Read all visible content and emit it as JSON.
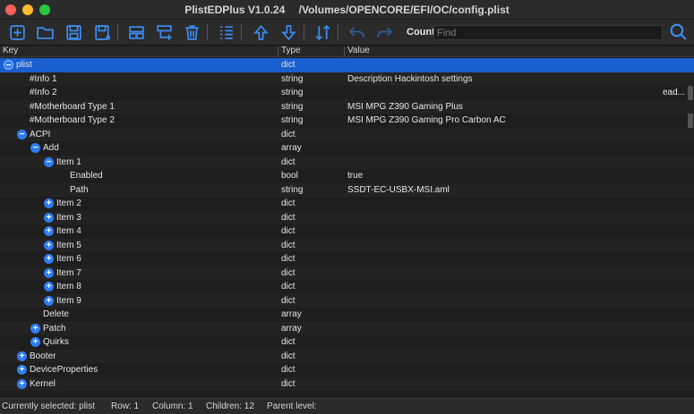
{
  "window": {
    "app_title": "PlistEDPlus  V1.0.24",
    "file_path": "/Volumes/OPENCORE/EFI/OC/config.plist"
  },
  "toolbar": {
    "count_label": "Count",
    "find_placeholder": "Find"
  },
  "columns": {
    "key": "Key",
    "type": "Type",
    "value": "Value"
  },
  "rows": [
    {
      "key": "plist",
      "type": "dict",
      "value": "",
      "toggle": "−",
      "level": 0
    },
    {
      "key": "#Info 1",
      "type": "string",
      "value": "Description Hackintosh settings",
      "toggle": "",
      "level": 1
    },
    {
      "key": "#Info 2",
      "type": "string",
      "value": "ead...",
      "toggle": "",
      "level": 1
    },
    {
      "key": "#Motherboard Type 1",
      "type": "string",
      "value": "MSI MPG Z390 Gaming Plus",
      "toggle": "",
      "level": 1
    },
    {
      "key": "#Motherboard Type 2",
      "type": "string",
      "value": "MSI MPG Z390 Gaming Pro Carbon AC",
      "toggle": "",
      "level": 1
    },
    {
      "key": "ACPI",
      "type": "dict",
      "value": "",
      "toggle": "−",
      "level": 1
    },
    {
      "key": "Add",
      "type": "array",
      "value": "",
      "toggle": "−",
      "level": 2
    },
    {
      "key": "Item 1",
      "type": "dict",
      "value": "",
      "toggle": "−",
      "level": 3
    },
    {
      "key": "Enabled",
      "type": "bool",
      "value": "true",
      "toggle": "",
      "level": 4
    },
    {
      "key": "Path",
      "type": "string",
      "value": "SSDT-EC-USBX-MSI.aml",
      "toggle": "",
      "level": 4
    },
    {
      "key": "Item 2",
      "type": "dict",
      "value": "",
      "toggle": "+",
      "level": 3
    },
    {
      "key": "Item 3",
      "type": "dict",
      "value": "",
      "toggle": "+",
      "level": 3
    },
    {
      "key": "Item 4",
      "type": "dict",
      "value": "",
      "toggle": "+",
      "level": 3
    },
    {
      "key": "Item 5",
      "type": "dict",
      "value": "",
      "toggle": "+",
      "level": 3
    },
    {
      "key": "Item 6",
      "type": "dict",
      "value": "",
      "toggle": "+",
      "level": 3
    },
    {
      "key": "Item 7",
      "type": "dict",
      "value": "",
      "toggle": "+",
      "level": 3
    },
    {
      "key": "Item 8",
      "type": "dict",
      "value": "",
      "toggle": "+",
      "level": 3
    },
    {
      "key": "Item 9",
      "type": "dict",
      "value": "",
      "toggle": "+",
      "level": 3
    },
    {
      "key": "Delete",
      "type": "array",
      "value": "",
      "toggle": "",
      "level": 2
    },
    {
      "key": "Patch",
      "type": "array",
      "value": "",
      "toggle": "+",
      "level": 2
    },
    {
      "key": "Quirks",
      "type": "dict",
      "value": "",
      "toggle": "+",
      "level": 2
    },
    {
      "key": "Booter",
      "type": "dict",
      "value": "",
      "toggle": "+",
      "level": 1
    },
    {
      "key": "DeviceProperties",
      "type": "dict",
      "value": "",
      "toggle": "+",
      "level": 1
    },
    {
      "key": "Kernel",
      "type": "dict",
      "value": "",
      "toggle": "+",
      "level": 1
    }
  ],
  "status": {
    "selected": "Currently selected: plist",
    "row": "Row: 1",
    "column": "Column: 1",
    "children": "Children: 12",
    "parent": "Parent level:"
  },
  "colors": {
    "accent": "#3d8ef5",
    "selection": "#1a5fd0"
  }
}
